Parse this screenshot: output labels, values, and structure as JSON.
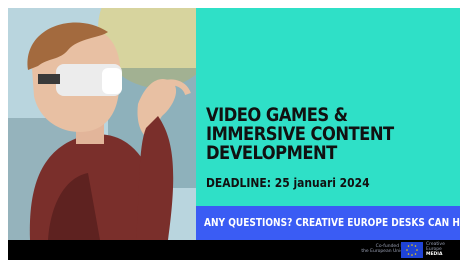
{
  "headline": {
    "line1": "VIDEO GAMES &",
    "line2": "IMMERSIVE CONTENT",
    "line3": "DEVELOPMENT"
  },
  "deadline": "DEADLINE: 25 januari 2024",
  "cta": "ANY QUESTIONS? CREATIVE EUROPE DESKS CAN HELP!",
  "footer": {
    "cofunded_line1": "Co-funded by",
    "cofunded_line2": "the European Union",
    "logo_line1": "Creative",
    "logo_line2": "Europe",
    "logo_line3": "MEDIA"
  },
  "colors": {
    "teal": "#2fe0c7",
    "cta_blue": "#3a5cf4",
    "eu_blue": "#1f43d6",
    "footer": "#000000"
  }
}
